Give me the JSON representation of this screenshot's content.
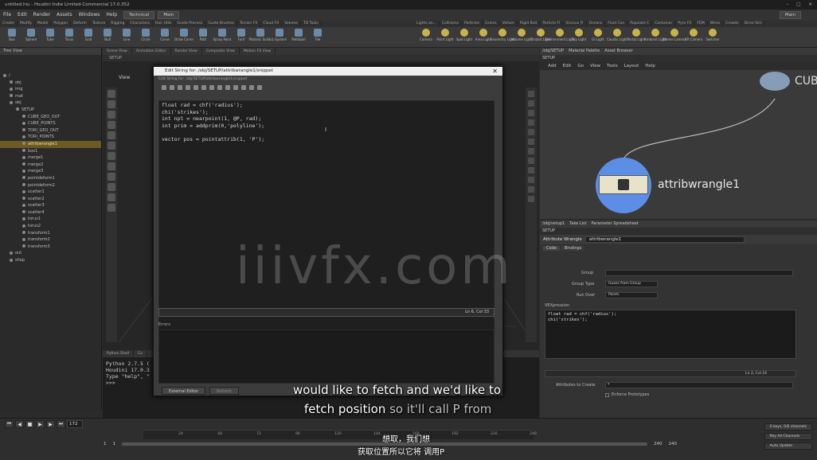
{
  "window": {
    "title": "untitled.hiu - Houdini Indie Limited-Commercial 17.0.352",
    "controls": [
      "–",
      "□",
      "✕"
    ]
  },
  "menu": [
    "File",
    "Edit",
    "Render",
    "Assets",
    "Windows",
    "Help"
  ],
  "desktop": {
    "name": "Technical",
    "main_label": "Main",
    "build": "Main"
  },
  "shelf": {
    "tabs": [
      "Create",
      "Modify",
      "Model",
      "Polygon",
      "Deform",
      "Texture",
      "Rigging",
      "Characters",
      "Hair Utils",
      "Guide Process",
      "Guide Brushes",
      "Terrain FX",
      "Cloud FX",
      "Volume",
      "TD Tools"
    ],
    "tools": [
      "Box",
      "Sphere",
      "Tube",
      "Torus",
      "Grid",
      "Null",
      "Line",
      "Circle",
      "Curve",
      "Draw Curve",
      "Path",
      "Spray Paint",
      "Font",
      "Platonic Solids",
      "L-System",
      "Metaball",
      "File"
    ],
    "light_tabs": [
      "Lights an...",
      "Collisions",
      "Particles",
      "Grains",
      "Vellum",
      "Rigid Bod",
      "Particle Fl",
      "Viscous Fl",
      "Oceans",
      "Fluid Con",
      "Populate C",
      "Container",
      "Pyro FX",
      "FEM",
      "Wires",
      "Crowds",
      "Drive Sim"
    ],
    "light_tools": [
      "Camera",
      "Point Light",
      "Spot Light",
      "Area Light",
      "Geometry Light",
      "Volume Light",
      "Distant Light",
      "Environment Light",
      "Sky Light",
      "GI Light",
      "Caustic Light",
      "Portal Light",
      "Ambient Light",
      "Stereo Camera",
      "VR Camera",
      "Switcher"
    ]
  },
  "tree": {
    "header": "Tree View",
    "items": [
      {
        "label": "/",
        "indent": 0
      },
      {
        "label": "obj",
        "indent": 1
      },
      {
        "label": "img",
        "indent": 1
      },
      {
        "label": "mat",
        "indent": 1
      },
      {
        "label": "obj",
        "indent": 1
      },
      {
        "label": "SETUP",
        "indent": 2
      },
      {
        "label": "CUBE_GEO_OUT",
        "indent": 3
      },
      {
        "label": "CUBE_POINTS",
        "indent": 3
      },
      {
        "label": "TORI_GEO_OUT",
        "indent": 3
      },
      {
        "label": "TORI_POINTS",
        "indent": 3
      },
      {
        "label": "attribwrangle1",
        "indent": 3,
        "selected": true
      },
      {
        "label": "box1",
        "indent": 3
      },
      {
        "label": "merge1",
        "indent": 3
      },
      {
        "label": "merge2",
        "indent": 3
      },
      {
        "label": "merge3",
        "indent": 3
      },
      {
        "label": "pointdeform1",
        "indent": 3
      },
      {
        "label": "pointdeform2",
        "indent": 3
      },
      {
        "label": "scatter1",
        "indent": 3
      },
      {
        "label": "scatter2",
        "indent": 3
      },
      {
        "label": "scatter3",
        "indent": 3
      },
      {
        "label": "scatter4",
        "indent": 3
      },
      {
        "label": "torus1",
        "indent": 3
      },
      {
        "label": "torus2",
        "indent": 3
      },
      {
        "label": "transform1",
        "indent": 3
      },
      {
        "label": "transform2",
        "indent": 3
      },
      {
        "label": "transform3",
        "indent": 3
      },
      {
        "label": "out",
        "indent": 1
      },
      {
        "label": "shop",
        "indent": 1
      }
    ]
  },
  "viewport": {
    "tabs": [
      "Scene View",
      "Animation Editor",
      "Render View",
      "Composite View",
      "Motion FX View"
    ],
    "view_label": "View",
    "path": "SETUP"
  },
  "dialog": {
    "title": "Edit String for: /obj/SETUP/attribwrangle1/snippet",
    "subpath": "Edit String for: /obj/SETUP/attribwrangle1/snippet",
    "code_lines": [
      "float rad = chf('radius');",
      "chi('strikes');",
      "int npt = nearpoint(1, @P, rad);",
      "int prim = addprim(0,'polyline');",
      "",
      "vector pos = pointattrib(1, 'P');"
    ],
    "cursor_pos": "Ln 6, Col 33",
    "errors_label": "Errors",
    "buttons": [
      "External Editor",
      "Refresh"
    ]
  },
  "python": {
    "tabs": [
      "Python Shell",
      "Co"
    ],
    "lines": [
      "Python 2.7.5 (",
      "Houdini 17.0.3",
      "Type \"help\", \"",
      ">>>"
    ]
  },
  "network": {
    "tabs": [
      "/obj/SETUP",
      "Material Palette",
      "Asset Browser"
    ],
    "path": "SETUP",
    "menu": [
      "Add",
      "Edit",
      "Go",
      "View",
      "Tools",
      "Layout",
      "Help"
    ],
    "node_name": "attribwrangle1",
    "other_node": "CUBE"
  },
  "params": {
    "tabs": [
      "/obj/setup1",
      "Take List",
      "Parameter Spreadsheet"
    ],
    "path": "SETUP",
    "node_type": "Attribute Wrangle",
    "node_name": "attribwrangle1",
    "sub_tabs": [
      "Code",
      "Bindings"
    ],
    "group_label": "Group",
    "group_type_label": "Group Type",
    "group_type_value": "Guess from Group",
    "run_over_label": "Run Over",
    "run_over_value": "Points",
    "vexpression_label": "VEXpression",
    "code_lines": [
      "float rad = chf('radius');",
      "chi('strikes');"
    ],
    "code_cursor": "Ln 2, Col 16",
    "attrs_label": "Attributes to Create",
    "attrs_value": "*",
    "enforce_label": "Enforce Prototypes"
  },
  "timeline": {
    "current_frame": "172",
    "start_frame": "1",
    "start_frame2": "1",
    "end_frame": "240",
    "end_frame2": "240",
    "ticks": [
      "24",
      "48",
      "72",
      "96",
      "120",
      "144",
      "168",
      "192",
      "216",
      "240"
    ],
    "keys_label": "0 keys, 0/0 channels",
    "key_all_label": "Key All Channels",
    "auto_update": "Auto Update"
  },
  "subtitles": {
    "en_line1": "would like to fetch and we'd like to",
    "en_line2_bright": "fetch position",
    "en_line2_dim": "so it'll call P from",
    "zh_line1": "想取，我们想",
    "zh_line2": "获取位置所以它将 调用P"
  },
  "watermark": "iiivfx.com"
}
